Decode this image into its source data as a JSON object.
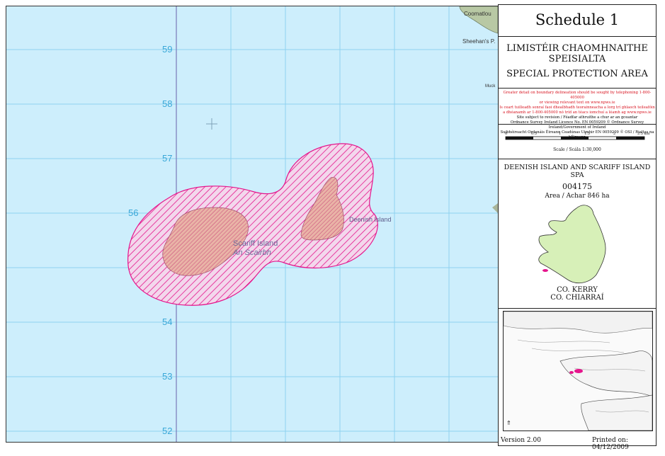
{
  "map": {
    "grid_labels": [
      "59",
      "58",
      "57",
      "56",
      "54",
      "53",
      "52"
    ],
    "place_labels": {
      "scariff_en": "Scariff Island",
      "scariff_ga": "An Scairbh",
      "deenish": "Deenish Island",
      "coomatlou": "Coomatlou",
      "sheehans": "Sheehan's P.",
      "muck": "Muck"
    },
    "spa_color": "#e5158c",
    "sea_color": "#cdeefc"
  },
  "panel": {
    "schedule_title": "Schedule 1",
    "irish_line1": "LIMISTÉIR CHAOMHNAITHE",
    "irish_line2": "SPEISIALTA",
    "english_line": "SPECIAL PROTECTION AREA",
    "notice_red": [
      "Greater detail on boundary delineation should be sought by telephoning 1-800-405000",
      "or viewing relevant text on www.npws.ie",
      "Is ceart tuilleadh sonraí faoi dhealbhadh teorainneacha a lorg trí ghlaoch teileafóin",
      "a dhéanamh ar 1-800-405000 nó tríd an téacs iomchuí a léamh ag www.npws.ie"
    ],
    "notice_black": [
      "Site subject to revision / Féadfar athruithe a chur ar an gceantar",
      "Ordnance Survey Ireland Licence No. EN 0059209 © Ordnance Survey Ireland/Government of Ireland",
      "Suibhéireacht Ordanáis Éireann Ceadúnas Uimhir EN 0059209 © OSI / Rialtas na hÉireann"
    ],
    "scale_ticks": [
      "0",
      "0.5",
      "1",
      "1.5",
      "2",
      "2.5 km"
    ],
    "scale_label": "Scale / Scála 1:30,000",
    "site_name": "DEENISH ISLAND AND SCARIFF ISLAND SPA",
    "site_code": "004175",
    "area": "Area / Achar 846 ha",
    "county_en": "CO. KERRY",
    "county_ga": "CO. CHIARRAÍ",
    "version": "Version 2.00",
    "printed": "Printed on: 04/12/2009"
  }
}
